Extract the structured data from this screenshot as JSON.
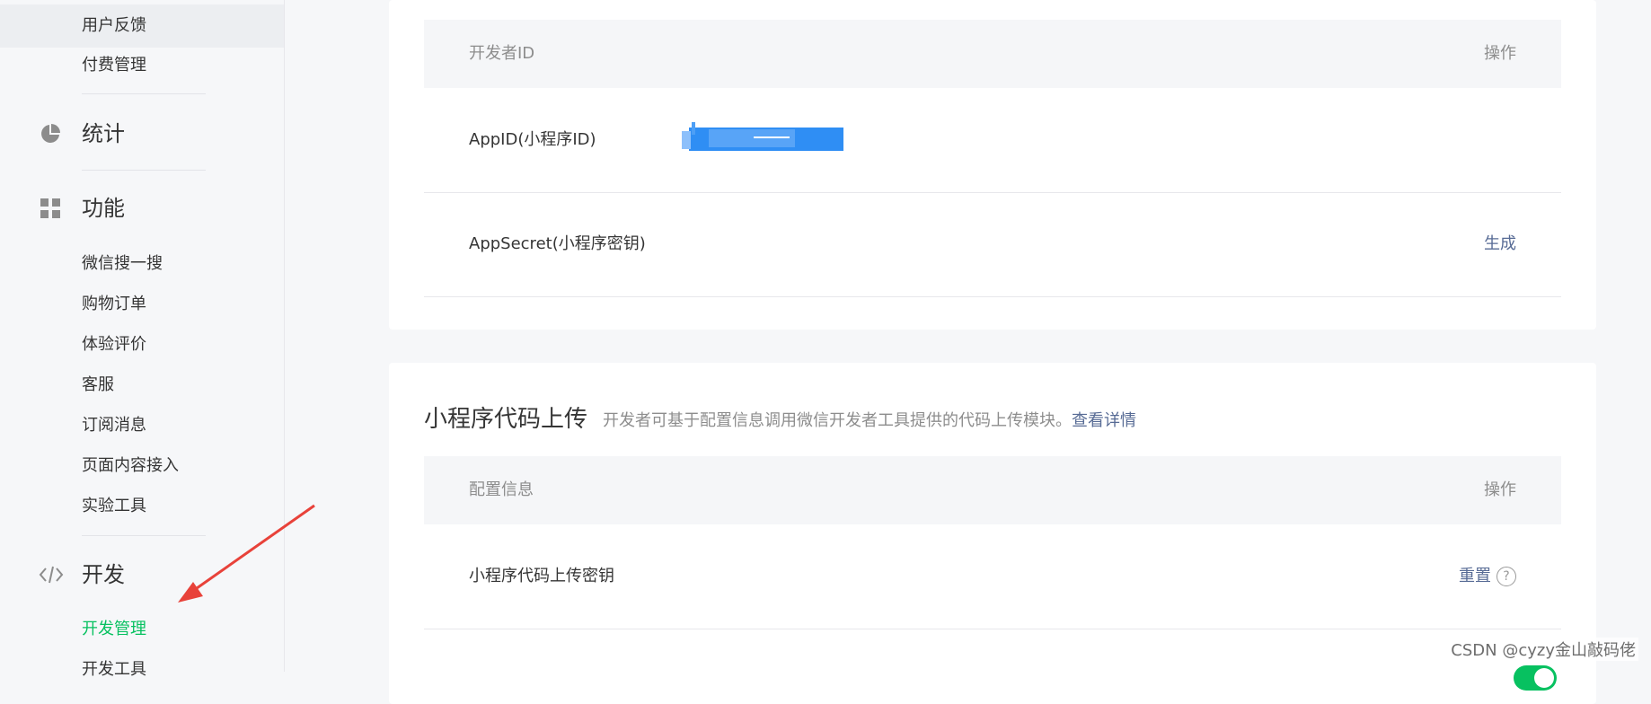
{
  "sidebar": {
    "top_items": [
      "用户反馈",
      "付费管理"
    ],
    "stats_section": {
      "label": "统计",
      "icon": "pie-chart-icon"
    },
    "features_section": {
      "label": "功能",
      "icon": "grid-icon",
      "items": [
        "微信搜一搜",
        "购物订单",
        "体验评价",
        "客服",
        "订阅消息",
        "页面内容接入",
        "实验工具"
      ]
    },
    "dev_section": {
      "label": "开发",
      "icon": "code-icon",
      "items": [
        "开发管理",
        "开发工具"
      ]
    }
  },
  "developer_id_card": {
    "header": {
      "col1": "开发者ID",
      "col2": "操作"
    },
    "rows": [
      {
        "name": "AppID(小程序ID)",
        "value_masked": true,
        "action": ""
      },
      {
        "name": "AppSecret(小程序密钥)",
        "action": "生成"
      }
    ]
  },
  "upload_card": {
    "title": "小程序代码上传",
    "description": "开发者可基于配置信息调用微信开发者工具提供的代码上传模块。",
    "link": "查看详情",
    "header": {
      "col1": "配置信息",
      "col2": "操作"
    },
    "rows": [
      {
        "name": "小程序代码上传密钥",
        "action": "重置",
        "help": "?"
      }
    ]
  },
  "watermark": "CSDN @cyzy金山敲码佬",
  "colors": {
    "accent_green": "#07c160",
    "link_blue": "#576b95",
    "annotation_red": "#e8423a"
  }
}
